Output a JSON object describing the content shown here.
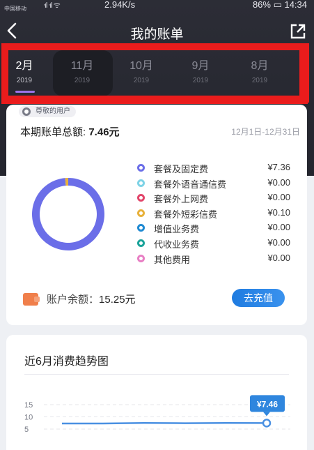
{
  "status_bar": {
    "carrier": "中国移动",
    "signal_icons": "ᐧıl ᐧıl ᯤ",
    "speed": "2.94K/s",
    "right": "86% ▭ 14:34"
  },
  "header": {
    "title": "我的账单"
  },
  "month_tabs": [
    {
      "month": "2月",
      "year": "2019",
      "active": true
    },
    {
      "month": "11月",
      "year": "2019",
      "active": false
    },
    {
      "month": "10月",
      "year": "2019",
      "active": false
    },
    {
      "month": "9月",
      "year": "2019",
      "active": false
    },
    {
      "month": "8月",
      "year": "2019",
      "active": false
    }
  ],
  "bill": {
    "user_badge": "尊敬的用户",
    "total_label": "本期账单总额: ",
    "total_value": "7.46元",
    "date_range": "12月1日-12月31日",
    "items": [
      {
        "name": "套餐及固定费",
        "value": "¥7.36",
        "amount": 7.36,
        "color": "#6b6ee8"
      },
      {
        "name": "套餐外语音通信费",
        "value": "¥0.00",
        "amount": 0.0,
        "color": "#7ed3e6"
      },
      {
        "name": "套餐外上网费",
        "value": "¥0.00",
        "amount": 0.0,
        "color": "#e2456a"
      },
      {
        "name": "套餐外短彩信费",
        "value": "¥0.10",
        "amount": 0.1,
        "color": "#e8b13a"
      },
      {
        "name": "增值业务费",
        "value": "¥0.00",
        "amount": 0.0,
        "color": "#1f8ad2"
      },
      {
        "name": "代收业务费",
        "value": "¥0.00",
        "amount": 0.0,
        "color": "#1aa39a"
      },
      {
        "name": "其他费用",
        "value": "¥0.00",
        "amount": 0.0,
        "color": "#e87fc4"
      }
    ],
    "balance_label": "账户余额：",
    "balance_value": "15.25元",
    "recharge_label": "去充值"
  },
  "trend": {
    "title": "近6月消费趋势图",
    "chart_data": {
      "type": "line",
      "y_ticks": [
        15,
        10,
        5
      ],
      "ylim": [
        0,
        20
      ],
      "last_value_label": "¥7.46",
      "series": [
        {
          "values": [
            7.3,
            7.3,
            7.5,
            7.4,
            7.5,
            7.46
          ]
        }
      ]
    }
  }
}
